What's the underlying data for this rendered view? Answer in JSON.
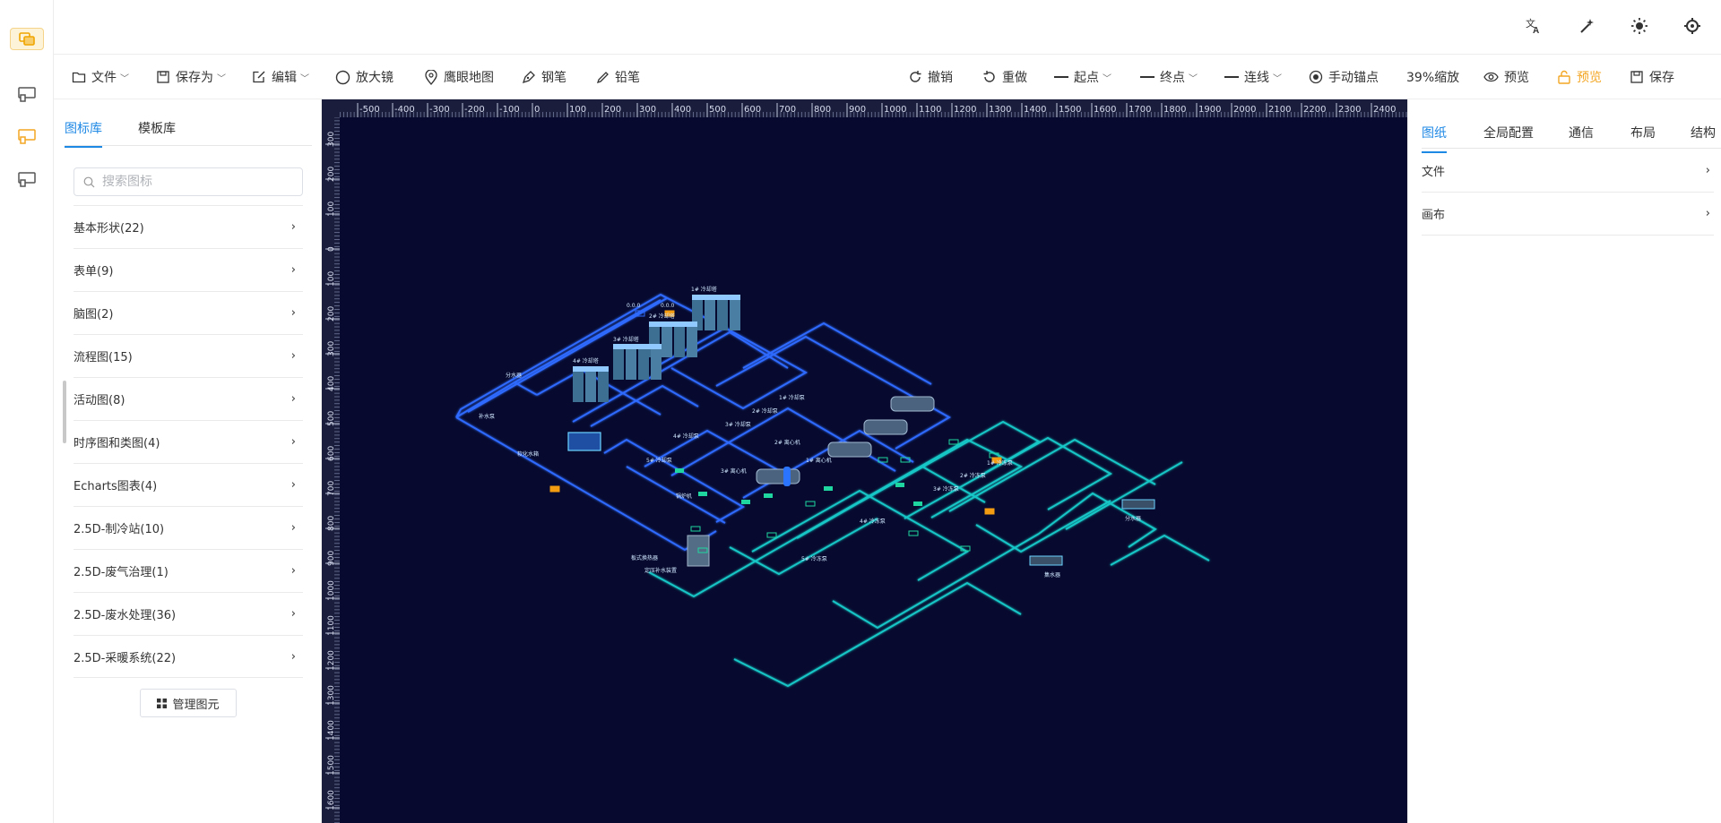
{
  "app": {
    "title": "2.5D 组态编辑器"
  },
  "header": {
    "icons": [
      "translate-icon",
      "magic-wand-icon",
      "sun-icon",
      "settings-icon"
    ]
  },
  "toolbar": {
    "file": "文件",
    "save_as": "保存为",
    "edit": "编辑",
    "magnifier": "放大镜",
    "eagle_map": "鹰眼地图",
    "pen": "钢笔",
    "pencil": "铅笔",
    "undo": "撤销",
    "redo": "重做",
    "start_point": "起点",
    "end_point": "终点",
    "connector": "连线",
    "manual_anchor": "手动锚点",
    "zoom": "39%缩放",
    "preview": "预览",
    "preview_active": "预览",
    "save": "保存",
    "accent_color": "#f3a623"
  },
  "left_panel": {
    "tabs": [
      {
        "label": "图标库",
        "active": true
      },
      {
        "label": "模板库",
        "active": false
      }
    ],
    "search_placeholder": "搜索图标",
    "categories": [
      "基本形状(22)",
      "表单(9)",
      "脑图(2)",
      "流程图(15)",
      "活动图(8)",
      "时序图和类图(4)",
      "Echarts图表(4)",
      "2.5D-制冷站(10)",
      "2.5D-废气治理(1)",
      "2.5D-废水处理(36)",
      "2.5D-采暖系统(22)"
    ],
    "manage_button": "管理图元"
  },
  "canvas": {
    "background": "#070a2e",
    "ruler_x": [
      "-500",
      "-400",
      "-300",
      "-200",
      "-100",
      "0",
      "100",
      "200",
      "300",
      "400",
      "500",
      "600",
      "700",
      "800",
      "900",
      "1000",
      "1100",
      "1200",
      "1300",
      "1400",
      "1500",
      "1600",
      "1700",
      "1800",
      "1900",
      "2000",
      "2100",
      "2200",
      "2300",
      "2400"
    ],
    "ruler_y": [
      "300",
      "200",
      "100",
      "0",
      "100",
      "200",
      "300",
      "400",
      "500",
      "600",
      "700",
      "800",
      "900",
      "1000",
      "1100",
      "1200",
      "1300",
      "1400",
      "1500",
      "1600"
    ],
    "labels": {
      "ct1": "1# 冷却塔",
      "ct2": "2# 冷却塔",
      "ct3": "3# 冷却塔",
      "ct4": "4# 冷却塔",
      "tank": "分水器",
      "makeup": "补水泵",
      "exch": "板式换热器",
      "sep": "分水器",
      "col": "集水器",
      "chiller1": "1# 离心机",
      "chiller2": "2# 离心机",
      "chiller3": "3# 离心机",
      "boiler": "锅炉机",
      "pump1": "1# 冷却泵",
      "pump2": "2# 冷却泵",
      "pump3": "3# 冷却泵",
      "pump4": "4# 冷却泵",
      "pump5": "5# 冷却泵",
      "cpump1": "1# 冷冻泵",
      "cpump2": "2# 冷冻泵",
      "cpump3": "3# 冷冻泵",
      "cpump4": "4# 冷冻泵",
      "cpump5": "5# 冷冻泵",
      "ctank": "定压补水装置",
      "softener": "软化水箱",
      "t1": "0.0.0",
      "t2": "0.0.0"
    }
  },
  "right_panel": {
    "tabs": [
      {
        "label": "图纸",
        "active": true
      },
      {
        "label": "全局配置",
        "active": false
      },
      {
        "label": "通信",
        "active": false
      },
      {
        "label": "布局",
        "active": false
      },
      {
        "label": "结构",
        "active": false
      }
    ],
    "sections": [
      "文件",
      "画布"
    ]
  }
}
